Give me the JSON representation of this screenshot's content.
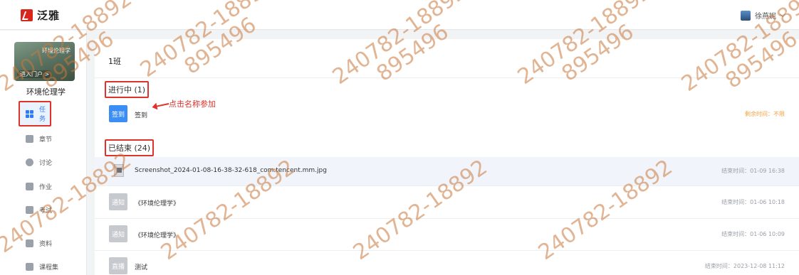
{
  "app": {
    "name": "泛雅",
    "user": "徐燕妮"
  },
  "sidebar": {
    "cover_title": "环境伦理学",
    "cover_tag": "进入门户 >",
    "course_name": "环境伦理学",
    "items": [
      {
        "label": "任务",
        "icon": "grid-icon"
      },
      {
        "label": "章节",
        "icon": "list-icon"
      },
      {
        "label": "讨论",
        "icon": "chat-icon"
      },
      {
        "label": "作业",
        "icon": "pencil-icon"
      },
      {
        "label": "考试",
        "icon": "exam-icon"
      },
      {
        "label": "资料",
        "icon": "folder-icon"
      },
      {
        "label": "课程集",
        "icon": "collection-icon"
      }
    ]
  },
  "main": {
    "class_name": "1班",
    "ongoing_label": "进行中 (1)",
    "ended_label": "已结束 (24)",
    "annotation": "点击名称参加",
    "ongoing": [
      {
        "badge": "签到",
        "title": "签到",
        "right": "剩余时间：不限"
      }
    ],
    "ended": [
      {
        "badge": "",
        "title": "Screenshot_2024-01-08-16-38-32-618_com.tencent.mm.jpg",
        "right": "结束时间：01-09 16:38"
      },
      {
        "badge": "通知",
        "title": "《环境伦理学》",
        "right": "结束时间：01-06 10:18"
      },
      {
        "badge": "通知",
        "title": "《环境伦理学》",
        "right": "结束时间：01-06 10:09"
      },
      {
        "badge": "直播",
        "title": "测试",
        "right": "结束时间：2023-12-08 11:12"
      }
    ]
  },
  "watermark": {
    "line1": "240782-18892",
    "line2": "895496"
  },
  "colors": {
    "accent": "#3a8ef6",
    "highlight_box": "#e0322b",
    "brand": "#d9261c"
  }
}
